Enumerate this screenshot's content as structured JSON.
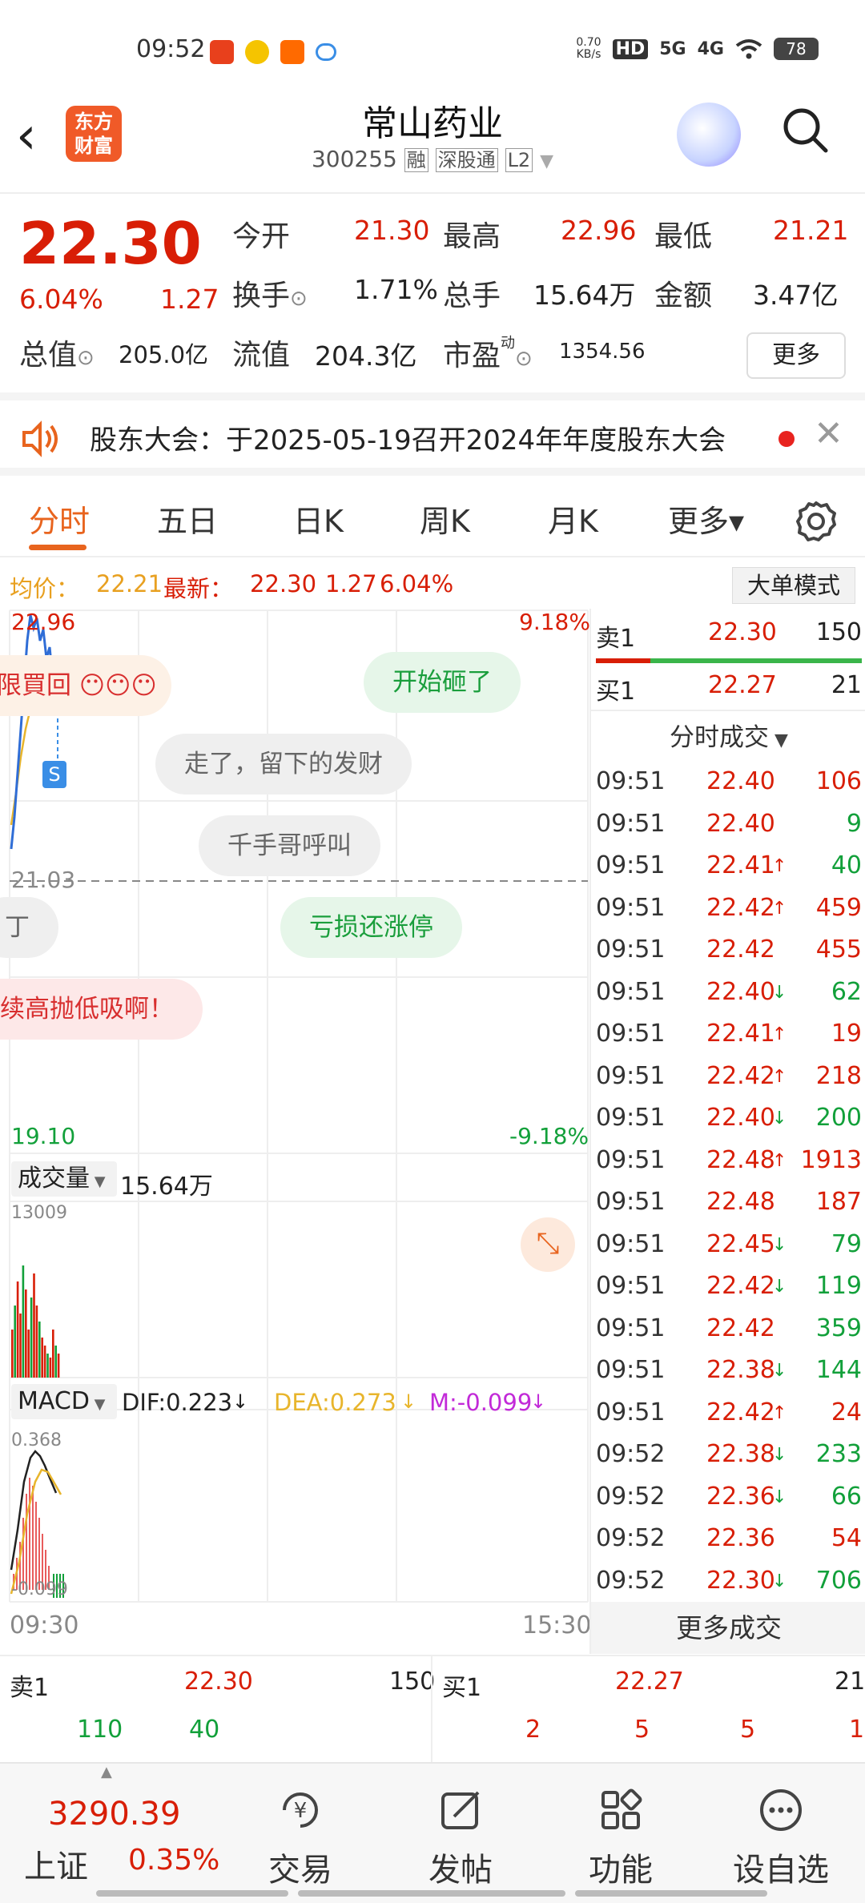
{
  "status_bar": {
    "time": "09:52",
    "net_speed_value": "0.70",
    "net_speed_unit": "KB/s",
    "hd": "HD",
    "sig1": "5G",
    "sig2": "4G",
    "battery": "78"
  },
  "header": {
    "back_icon": "chevron-left-icon",
    "logo_line1": "东方",
    "logo_line2": "财富",
    "stock_name": "常山药业",
    "stock_code": "300255",
    "tag_margin": "融",
    "tag_connect": "深股通",
    "tag_level": "L2"
  },
  "quote": {
    "price": "22.30",
    "change_pct": "6.04%",
    "change_amt": "1.27",
    "open_label": "今开",
    "open": "21.30",
    "high_label": "最高",
    "high": "22.96",
    "low_label": "最低",
    "low": "21.21",
    "turnover_label": "换手",
    "turnover": "1.71%",
    "volume_label": "总手",
    "volume": "15.64万",
    "amount_label": "金额",
    "amount": "3.47亿",
    "mktcap_label": "总值",
    "mktcap": "205.0亿",
    "float_label": "流值",
    "float": "204.3亿",
    "pe_label": "市盈",
    "pe_sup": "动",
    "pe": "1354.56",
    "more": "更多"
  },
  "notice": {
    "text": "股东大会：于2025-05-19召开2024年年度股东大会"
  },
  "tabs": [
    {
      "label": "分时",
      "active": true
    },
    {
      "label": "五日"
    },
    {
      "label": "日K"
    },
    {
      "label": "周K"
    },
    {
      "label": "月K"
    },
    {
      "label": "更多▾"
    }
  ],
  "avg_bar": {
    "avg_label": "均价：",
    "avg": "22.21",
    "latest_label": "最新：",
    "latest": "22.30",
    "latest_chg": "1.27",
    "latest_pct": "6.04%",
    "mode_button": "大单模式"
  },
  "chart_labels": {
    "high_price": "22.96",
    "high_pct": "9.18%",
    "prev_close": "21.03",
    "low_price": "19.10",
    "low_pct": "-9.18%",
    "volume_selector": "成交量",
    "volume_total": "15.64万",
    "volume_max": "13009",
    "macd_selector": "MACD",
    "dif": "DIF:0.223",
    "dea": "DEA:0.273",
    "m": "M:-0.099",
    "macd_max": "0.368",
    "macd_min": "-0.099",
    "time_start": "09:30",
    "time_end": "15:30",
    "s_marker": "S"
  },
  "comments": [
    {
      "text": "限買回",
      "style": "peach"
    },
    {
      "text": "开始砸了",
      "style": "green"
    },
    {
      "text": "走了，留下的发财",
      "style": "gray"
    },
    {
      "text": "千手哥呼叫",
      "style": "gray"
    },
    {
      "text": "丁",
      "style": "gray"
    },
    {
      "text": "亏损还涨停",
      "style": "green"
    },
    {
      "text": "续高抛低吸啊！",
      "style": "pink"
    }
  ],
  "order_book": {
    "sell1": {
      "label": "卖1",
      "price": "22.30",
      "qty": "150"
    },
    "buy1": {
      "label": "买1",
      "price": "22.27",
      "qty": "21"
    },
    "bottom_sell_qtys": [
      "110",
      "40"
    ],
    "bottom_buy_qtys": [
      "2",
      "5",
      "5",
      "1"
    ]
  },
  "trades_title": "分时成交",
  "trades": [
    {
      "time": "09:51",
      "price": "22.40",
      "dir": "",
      "qty": "106",
      "color": "red"
    },
    {
      "time": "09:51",
      "price": "22.40",
      "dir": "",
      "qty": "9",
      "color": "green"
    },
    {
      "time": "09:51",
      "price": "22.41",
      "dir": "↑",
      "qty": "40",
      "color": "green"
    },
    {
      "time": "09:51",
      "price": "22.42",
      "dir": "↑",
      "qty": "459",
      "color": "red"
    },
    {
      "time": "09:51",
      "price": "22.42",
      "dir": "",
      "qty": "455",
      "color": "red"
    },
    {
      "time": "09:51",
      "price": "22.40",
      "dir": "↓",
      "qty": "62",
      "color": "green"
    },
    {
      "time": "09:51",
      "price": "22.41",
      "dir": "↑",
      "qty": "19",
      "color": "red"
    },
    {
      "time": "09:51",
      "price": "22.42",
      "dir": "↑",
      "qty": "218",
      "color": "red"
    },
    {
      "time": "09:51",
      "price": "22.40",
      "dir": "↓",
      "qty": "200",
      "color": "green"
    },
    {
      "time": "09:51",
      "price": "22.48",
      "dir": "↑",
      "qty": "1913",
      "color": "red"
    },
    {
      "time": "09:51",
      "price": "22.48",
      "dir": "",
      "qty": "187",
      "color": "red"
    },
    {
      "time": "09:51",
      "price": "22.45",
      "dir": "↓",
      "qty": "79",
      "color": "green"
    },
    {
      "time": "09:51",
      "price": "22.42",
      "dir": "↓",
      "qty": "119",
      "color": "green"
    },
    {
      "time": "09:51",
      "price": "22.42",
      "dir": "",
      "qty": "359",
      "color": "green"
    },
    {
      "time": "09:51",
      "price": "22.38",
      "dir": "↓",
      "qty": "144",
      "color": "green"
    },
    {
      "time": "09:51",
      "price": "22.42",
      "dir": "↑",
      "qty": "24",
      "color": "red"
    },
    {
      "time": "09:52",
      "price": "22.38",
      "dir": "↓",
      "qty": "233",
      "color": "green"
    },
    {
      "time": "09:52",
      "price": "22.36",
      "dir": "↓",
      "qty": "66",
      "color": "green"
    },
    {
      "time": "09:52",
      "price": "22.36",
      "dir": "",
      "qty": "54",
      "color": "red"
    },
    {
      "time": "09:52",
      "price": "22.30",
      "dir": "↓",
      "qty": "706",
      "color": "green"
    }
  ],
  "more_trades": "更多成交",
  "bottom_nav": {
    "index_value": "3290.39",
    "index_name": "上证",
    "index_pct": "0.35%",
    "items": [
      {
        "label": "交易",
        "icon": "yuan-refresh-icon"
      },
      {
        "label": "发帖",
        "icon": "edit-icon"
      },
      {
        "label": "功能",
        "icon": "grid-icon"
      },
      {
        "label": "设自选",
        "icon": "more-dots-icon"
      }
    ]
  },
  "colors": {
    "up": "#d81e06",
    "down": "#12a03a",
    "accent": "#e8641e",
    "avg_line": "#e8b52c",
    "price_line": "#2f6dd6"
  }
}
